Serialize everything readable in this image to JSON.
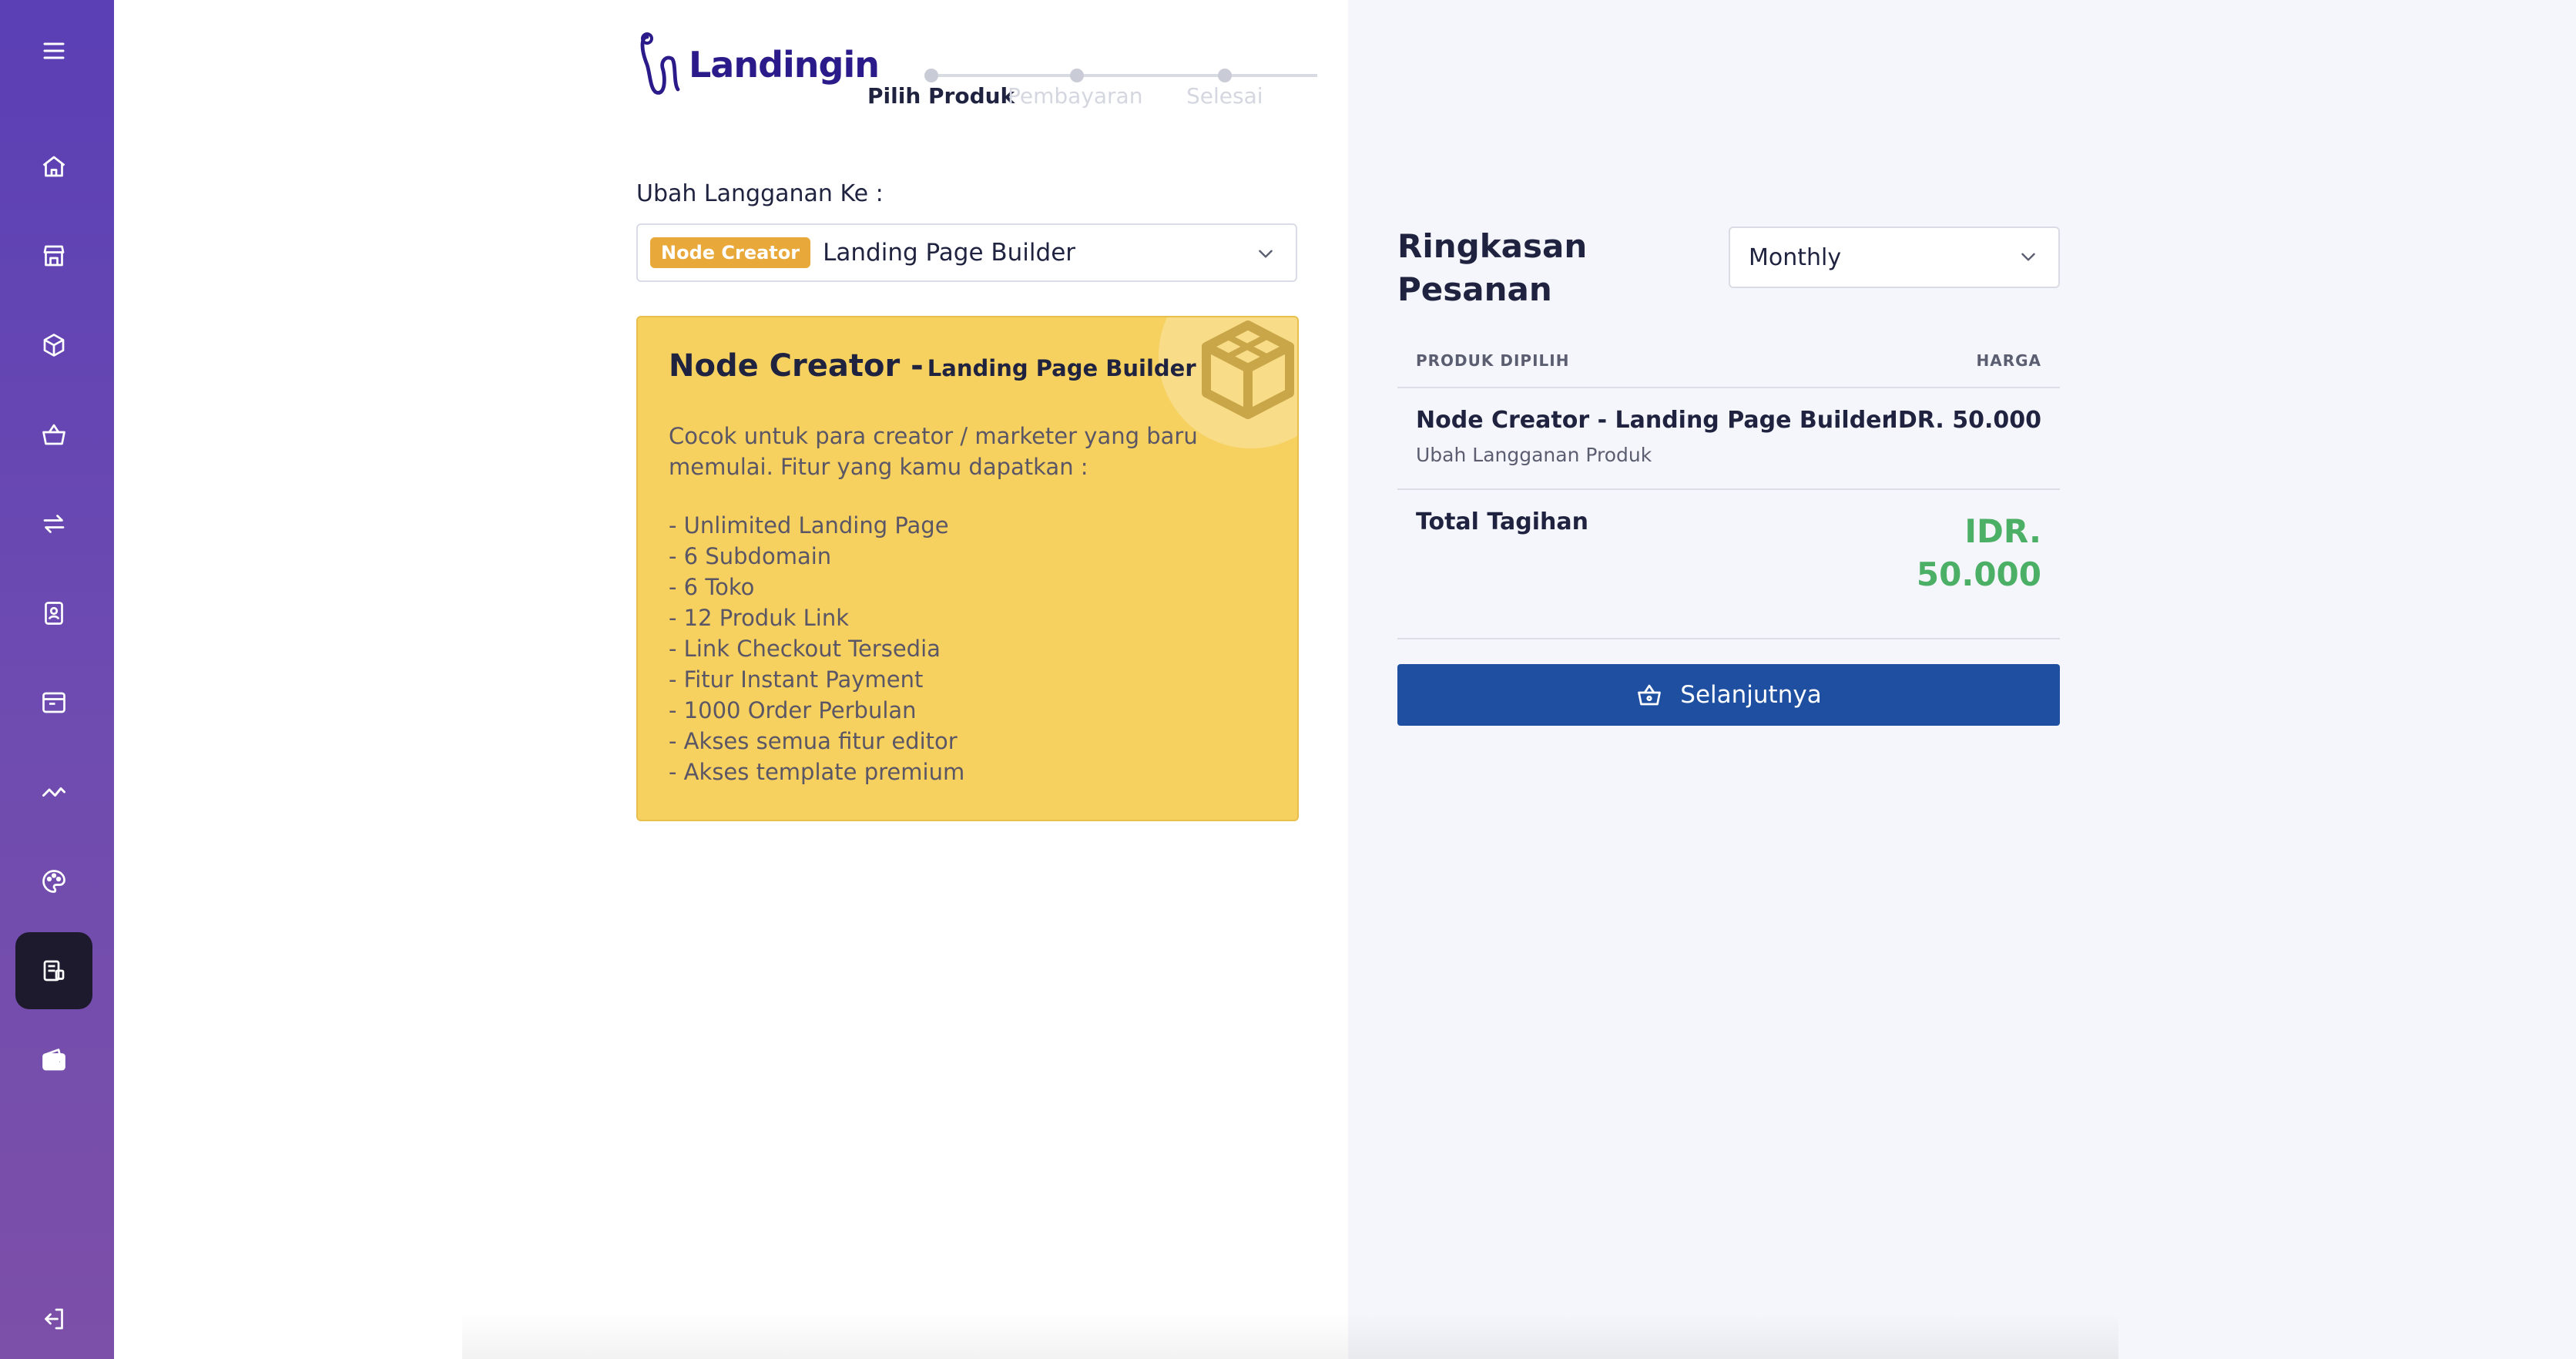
{
  "brand": {
    "name": "Landingin"
  },
  "stepper": {
    "steps": [
      {
        "label": "Pilih Produk",
        "active": true
      },
      {
        "label": "Pembayaran",
        "active": false
      },
      {
        "label": "Selesai",
        "active": false
      }
    ]
  },
  "form": {
    "subscription_label": "Ubah Langganan Ke :",
    "selected_badge": "Node Creator",
    "selected_product": "Landing Page Builder"
  },
  "card": {
    "title": "Node Creator -",
    "subtitle": "Landing Page Builder",
    "description": "Cocok untuk para creator / marketer yang baru memulai. Fitur yang kamu dapatkan :",
    "features": [
      "- Unlimited Landing Page",
      "- 6 Subdomain",
      "- 6 Toko",
      "- 12 Produk Link",
      "- Link Checkout Tersedia",
      "- Fitur Instant Payment",
      "- 1000 Order Perbulan",
      "- Akses semua fitur editor",
      "- Akses template premium"
    ]
  },
  "summary": {
    "title": "Ringkasan Pesanan",
    "period": "Monthly",
    "col_product": "PRODUK DIPILIH",
    "col_price": "HARGA",
    "item_name": "Node Creator - Landing Page Builder",
    "item_sub": "Ubah Langganan Produk",
    "item_price": "IDR. 50.000",
    "total_label": "Total Tagihan",
    "total_amount": "IDR. 50.000",
    "next_label": "Selanjutnya"
  },
  "colors": {
    "sidebar_top": "#5a3fb5",
    "sidebar_bottom": "#7c4fa8",
    "card_bg": "#f6d160",
    "badge": "#e8a83a",
    "total": "#4caf66",
    "button": "#1f4fa0"
  },
  "sidebar": {
    "items": [
      {
        "icon": "menu-icon"
      },
      {
        "icon": "home-icon"
      },
      {
        "icon": "store-icon"
      },
      {
        "icon": "box-icon"
      },
      {
        "icon": "basket-icon"
      },
      {
        "icon": "transfer-icon"
      },
      {
        "icon": "contact-icon"
      },
      {
        "icon": "browser-icon"
      },
      {
        "icon": "analytics-icon"
      },
      {
        "icon": "palette-icon"
      },
      {
        "icon": "billing-icon",
        "active": true
      },
      {
        "icon": "wallet-icon"
      },
      {
        "icon": "logout-icon"
      }
    ]
  }
}
